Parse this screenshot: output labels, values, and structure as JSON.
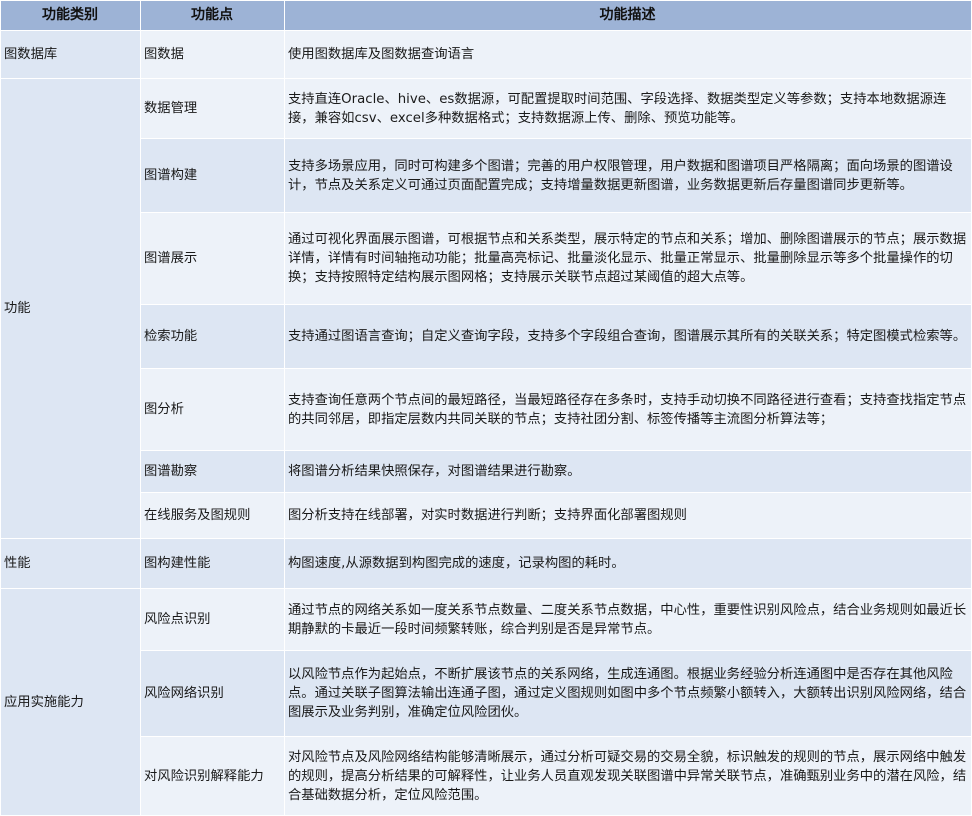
{
  "header": {
    "category": "功能类别",
    "feature": "功能点",
    "description": "功能描述"
  },
  "groups": [
    {
      "category": "图数据库",
      "rows": [
        {
          "feature": "图数据",
          "description": "使用图数据库及图数据查询语言"
        }
      ]
    },
    {
      "category": "功能",
      "rows": [
        {
          "feature": "数据管理",
          "description": "支持直连Oracle、hive、es数据源，可配置提取时间范围、字段选择、数据类型定义等参数；支持本地数据源连接，兼容如csv、excel多种数据格式；支持数据源上传、删除、预览功能等。"
        },
        {
          "feature": "图谱构建",
          "description": "支持多场景应用，同时可构建多个图谱；完善的用户权限管理，用户数据和图谱项目严格隔离；面向场景的图谱设计，节点及关系定义可通过页面配置完成；支持增量数据更新图谱，业务数据更新后存量图谱同步更新等。"
        },
        {
          "feature": "图谱展示",
          "description": "通过可视化界面展示图谱，可根据节点和关系类型，展示特定的节点和关系；增加、删除图谱展示的节点；展示数据详情，详情有时间轴拖动功能；批量高亮标记、批量淡化显示、批量正常显示、批量删除显示等多个批量操作的切换；支持按照特定结构展示图网格；支持展示关联节点超过某阈值的超大点等。"
        },
        {
          "feature": "检索功能",
          "description": "支持通过图语言查询；自定义查询字段，支持多个字段组合查询，图谱展示其所有的关联关系；特定图模式检索等。"
        },
        {
          "feature": "图分析",
          "description": "支持查询任意两个节点间的最短路径，当最短路径存在多条时，支持手动切换不同路径进行查看；支持查找指定节点的共同邻居，即指定层数内共同关联的节点；支持社团分割、标签传播等主流图分析算法等；"
        },
        {
          "feature": "图谱勘察",
          "description": "将图谱分析结果快照保存，对图谱结果进行勘察。"
        },
        {
          "feature": "在线服务及图规则",
          "description": "图分析支持在线部署，对实时数据进行判断；支持界面化部署图规则"
        }
      ]
    },
    {
      "category": "性能",
      "rows": [
        {
          "feature": "图构建性能",
          "description": "构图速度,从源数据到构图完成的速度，记录构图的耗时。"
        }
      ]
    },
    {
      "category": "应用实施能力",
      "rows": [
        {
          "feature": "风险点识别",
          "description": "通过节点的网络关系如一度关系节点数量、二度关系节点数据，中心性，重要性识别风险点，结合业务规则如最近长期静默的卡最近一段时间频繁转账，综合判别是否是异常节点。"
        },
        {
          "feature": "风险网络识别",
          "description": "以风险节点作为起始点，不断扩展该节点的关系网络，生成连通图。根据业务经验分析连通图中是否存在其他风险点。通过关联子图算法输出连通子图，通过定义图规则如图中多个节点频繁小额转入，大额转出识别风险网络，结合图展示及业务判别，准确定位风险团伙。"
        },
        {
          "feature": "对风险识别解释能力",
          "description": "对风险节点及风险网络结构能够清晰展示，通过分析可疑交易的交易全貌，标识触发的规则的节点，展示网络中触发的规则，提高分析结果的可解释性，让业务人员直观发现关联图谱中异常关联节点，准确甄别业务中的潜在风险，结合基础数据分析，定位风险范围。"
        }
      ]
    }
  ]
}
